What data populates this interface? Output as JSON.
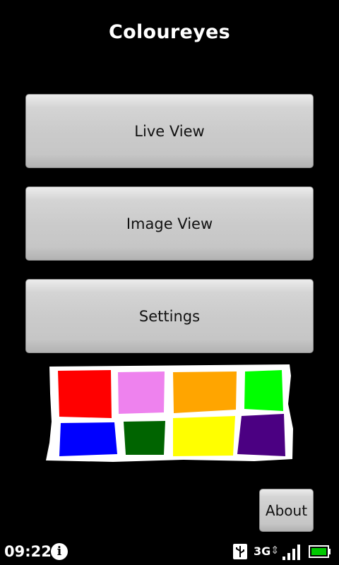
{
  "app": {
    "title": "Coloureyes"
  },
  "menu": {
    "live_view_label": "Live View",
    "image_view_label": "Image View",
    "settings_label": "Settings",
    "about_label": "About"
  },
  "palette": {
    "swatches": [
      {
        "name": "red",
        "color": "#ff0000"
      },
      {
        "name": "pink",
        "color": "#ee82ee"
      },
      {
        "name": "orange",
        "color": "#ffa500"
      },
      {
        "name": "green",
        "color": "#00ff00"
      },
      {
        "name": "blue",
        "color": "#0000ff"
      },
      {
        "name": "dark-green",
        "color": "#006400"
      },
      {
        "name": "yellow",
        "color": "#ffff00"
      },
      {
        "name": "indigo",
        "color": "#4b0082"
      }
    ],
    "outline_color": "#ffffff"
  },
  "status_bar": {
    "time": "09:22",
    "network_type": "3G",
    "icons": [
      "info-icon",
      "usb-icon",
      "data-arrows-icon",
      "signal-icon",
      "battery-icon"
    ],
    "battery_color": "#00c800"
  },
  "colors": {
    "background": "#000000",
    "button_face": "#cbcbcb",
    "title_text": "#ffffff"
  }
}
